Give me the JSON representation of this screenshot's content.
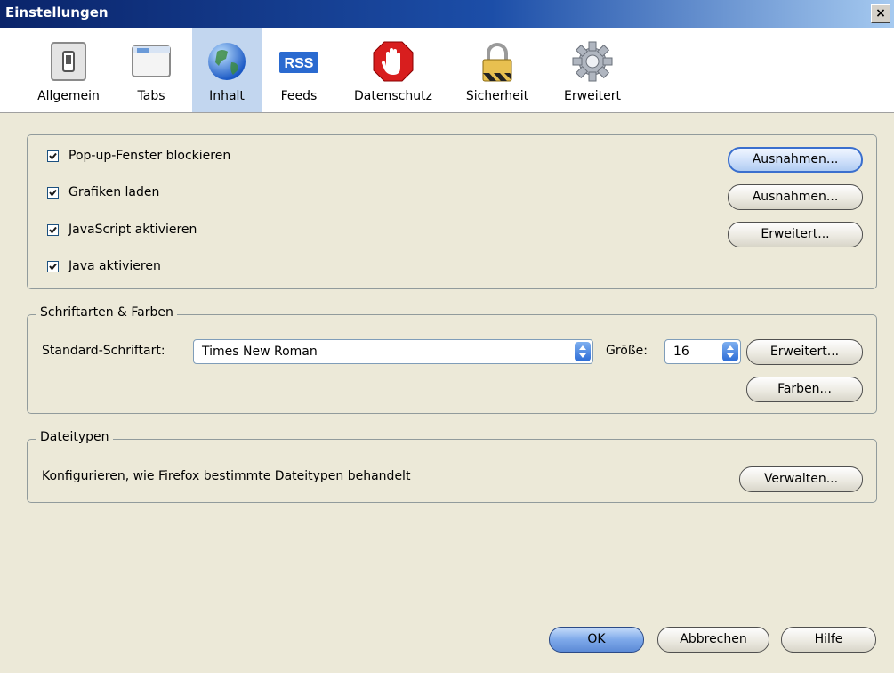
{
  "window": {
    "title": "Einstellungen",
    "close_symbol": "×"
  },
  "tabs": [
    {
      "label": "Allgemein",
      "icon": "switch-icon"
    },
    {
      "label": "Tabs",
      "icon": "tabs-window-icon"
    },
    {
      "label": "Inhalt",
      "icon": "globe-icon",
      "selected": true
    },
    {
      "label": "Feeds",
      "icon": "rss-icon"
    },
    {
      "label": "Datenschutz",
      "icon": "stop-hand-icon"
    },
    {
      "label": "Sicherheit",
      "icon": "padlock-icon"
    },
    {
      "label": "Erweitert",
      "icon": "gear-icon"
    }
  ],
  "content": {
    "popups": {
      "label": "Pop-up-Fenster blockieren",
      "checked": true,
      "button": "Ausnahmen..."
    },
    "images": {
      "label": "Grafiken laden",
      "checked": true,
      "button": "Ausnahmen..."
    },
    "javascript": {
      "label": "JavaScript aktivieren",
      "checked": true,
      "button": "Erweitert..."
    },
    "java": {
      "label": "Java aktivieren",
      "checked": true
    }
  },
  "fonts": {
    "legend": "Schriftarten & Farben",
    "default_font_label": "Standard-Schriftart:",
    "default_font_value": "Times New Roman",
    "size_label": "Größe:",
    "size_value": "16",
    "advanced_button": "Erweitert...",
    "colors_button": "Farben..."
  },
  "filetypes": {
    "legend": "Dateitypen",
    "description": "Konfigurieren, wie Firefox bestimmte Dateitypen behandelt",
    "manage_button": "Verwalten..."
  },
  "footer": {
    "ok": "OK",
    "cancel": "Abbrechen",
    "help": "Hilfe"
  },
  "colors": {
    "title_bar": "#0a246a",
    "selected_tab": "#c2d6ef",
    "dialog_bg": "#ece9d8"
  }
}
